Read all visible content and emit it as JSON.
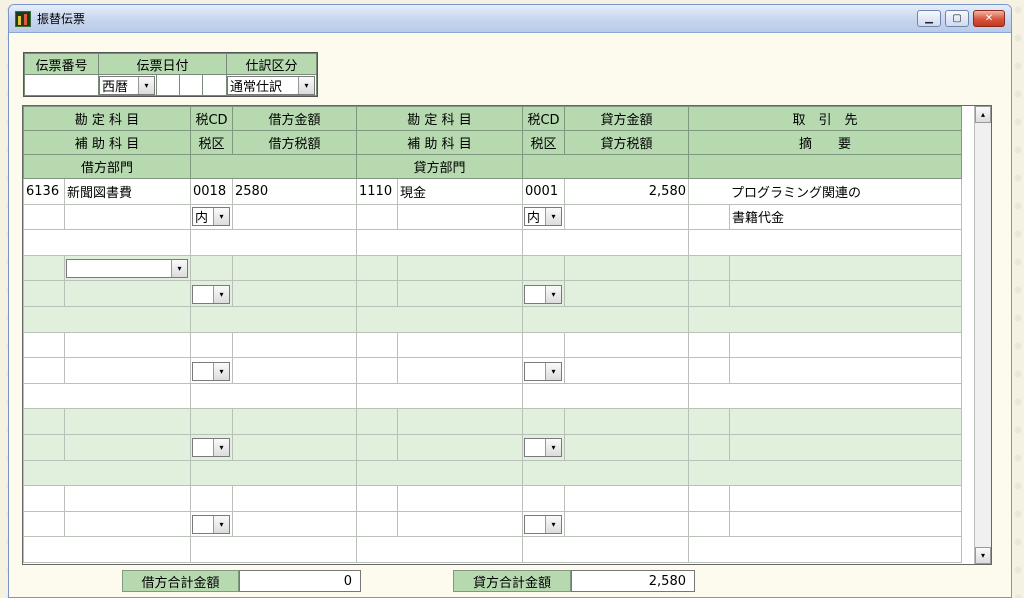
{
  "window": {
    "title": "振替伝票"
  },
  "header": {
    "labels": {
      "voucher_no": "伝票番号",
      "voucher_date": "伝票日付",
      "entry_type": "仕訳区分"
    },
    "voucher_no_value": "",
    "era_value": "西暦",
    "date_parts": [
      "",
      "",
      ""
    ],
    "entry_type_value": "通常仕訳"
  },
  "grid": {
    "header_row1": [
      "勘 定 科 目",
      "税CD",
      "借方金額",
      "勘 定 科 目",
      "税CD",
      "貸方金額",
      "取　引　先"
    ],
    "header_row2": [
      "補 助 科 目",
      "税区",
      "借方税額",
      "補 助 科 目",
      "税区",
      "貸方税額",
      "摘　　要"
    ],
    "header_row3": [
      "借方部門",
      "",
      "貸方部門",
      "",
      ""
    ],
    "entry1": {
      "debit_code": "6136",
      "debit_account": "新聞図書費",
      "debit_tax_cd": "0018",
      "debit_amount": "2580",
      "credit_code": "1110",
      "credit_account": "現金",
      "credit_tax_cd": "0001",
      "credit_amount": "2,580",
      "partner_line1": "プログラミング関連の",
      "partner_line2": "書籍代金",
      "debit_tax_kbn": "内",
      "credit_tax_kbn": "内"
    }
  },
  "totals": {
    "debit_label": "借方合計金額",
    "debit_value": "0",
    "credit_label": "貸方合計金額",
    "credit_value": "2,580"
  },
  "icons": {
    "dropdown": "▾",
    "scroll_up": "▴",
    "scroll_down": "▾"
  }
}
